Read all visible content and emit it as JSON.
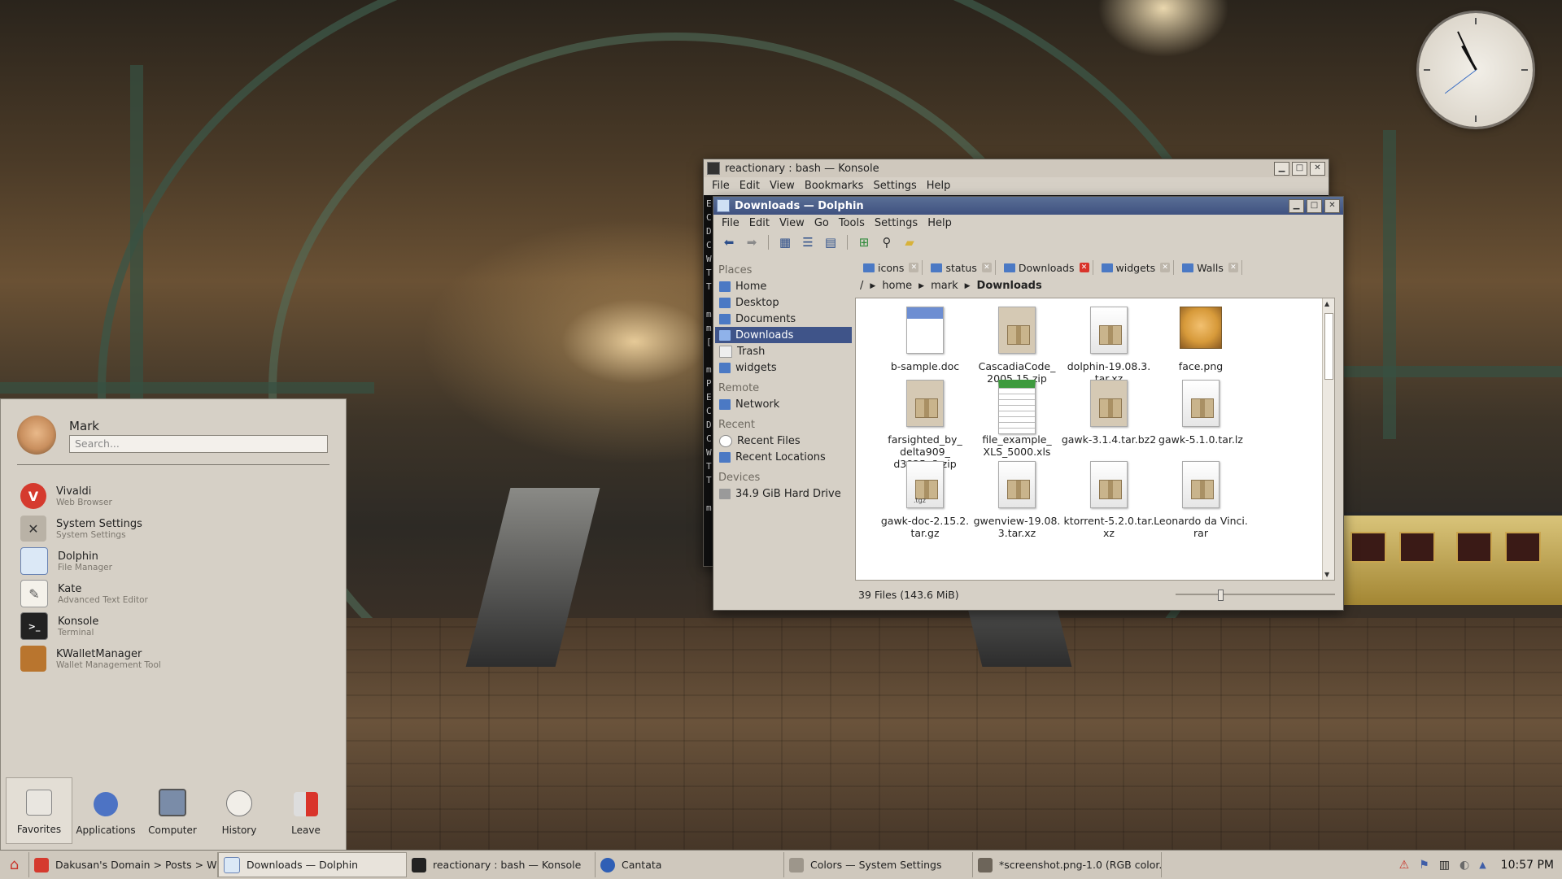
{
  "konsole": {
    "title": "reactionary : bash — Konsole",
    "menu": [
      "File",
      "Edit",
      "View",
      "Bookmarks",
      "Settings",
      "Help"
    ],
    "terminal_lines": [
      "E",
      "C",
      "D",
      "C",
      "W",
      "T",
      "T",
      "",
      "m",
      "m",
      "[",
      "",
      "m",
      "P",
      "E",
      "C",
      "D",
      "C",
      "W",
      "T",
      "T",
      "",
      "m"
    ]
  },
  "dolphin": {
    "title": "Downloads — Dolphin",
    "menu": [
      "File",
      "Edit",
      "View",
      "Go",
      "Tools",
      "Settings",
      "Help"
    ],
    "places": {
      "places_header": "Places",
      "items": [
        "Home",
        "Desktop",
        "Documents",
        "Downloads",
        "Trash",
        "widgets"
      ],
      "remote_header": "Remote",
      "remote": [
        "Network"
      ],
      "recent_header": "Recent",
      "recent": [
        "Recent Files",
        "Recent Locations"
      ],
      "devices_header": "Devices",
      "devices": [
        "34.9 GiB Hard Drive"
      ]
    },
    "tabs": [
      "icons",
      "status",
      "Downloads",
      "widgets",
      "Walls"
    ],
    "active_tab": "Downloads",
    "breadcrumb": [
      "/",
      "home",
      "mark",
      "Downloads"
    ],
    "files": [
      [
        "b-sample.doc"
      ],
      [
        "CascadiaCode_",
        "2005.15.zip"
      ],
      [
        "dolphin-19.08.3.",
        "tar.xz"
      ],
      [
        "face.png"
      ],
      [
        "farsighted_by_",
        "delta909_",
        "d3825a3.zip"
      ],
      [
        "file_example_",
        "XLS_5000.xls"
      ],
      [
        "gawk-3.1.4.tar.bz2"
      ],
      [
        "gawk-5.1.0.tar.lz"
      ],
      [
        "gawk-doc-2.15.2.",
        "tar.gz"
      ],
      [
        "gwenview-19.08.",
        "3.tar.xz"
      ],
      [
        "ktorrent-5.2.0.tar.",
        "xz"
      ],
      [
        "Leonardo da Vinci.",
        "rar"
      ]
    ],
    "tgz_label": ".tgz",
    "status": "39 Files (143.6 MiB)"
  },
  "kickoff": {
    "user": "Mark",
    "search_placeholder": "Search...",
    "apps": [
      {
        "name": "Vivaldi",
        "desc": "Web Browser"
      },
      {
        "name": "System Settings",
        "desc": "System Settings"
      },
      {
        "name": "Dolphin",
        "desc": "File Manager"
      },
      {
        "name": "Kate",
        "desc": "Advanced Text Editor"
      },
      {
        "name": "Konsole",
        "desc": "Terminal"
      },
      {
        "name": "KWalletManager",
        "desc": "Wallet Management Tool"
      }
    ],
    "tabs": [
      "Favorites",
      "Applications",
      "Computer",
      "History",
      "Leave"
    ]
  },
  "taskbar": {
    "tasks": [
      "Dakusan's Domain > Posts > Wi...",
      "Downloads — Dolphin",
      "reactionary : bash — Konsole",
      "Cantata",
      "Colors  — System Settings",
      "*screenshot.png-1.0 (RGB color..."
    ],
    "clock": "10:57 PM"
  },
  "colors": {
    "accent": "#3f5489",
    "titlebar_active": "#4a5d8c",
    "window_bg": "#d6d0c6",
    "close_red": "#d9342b"
  }
}
